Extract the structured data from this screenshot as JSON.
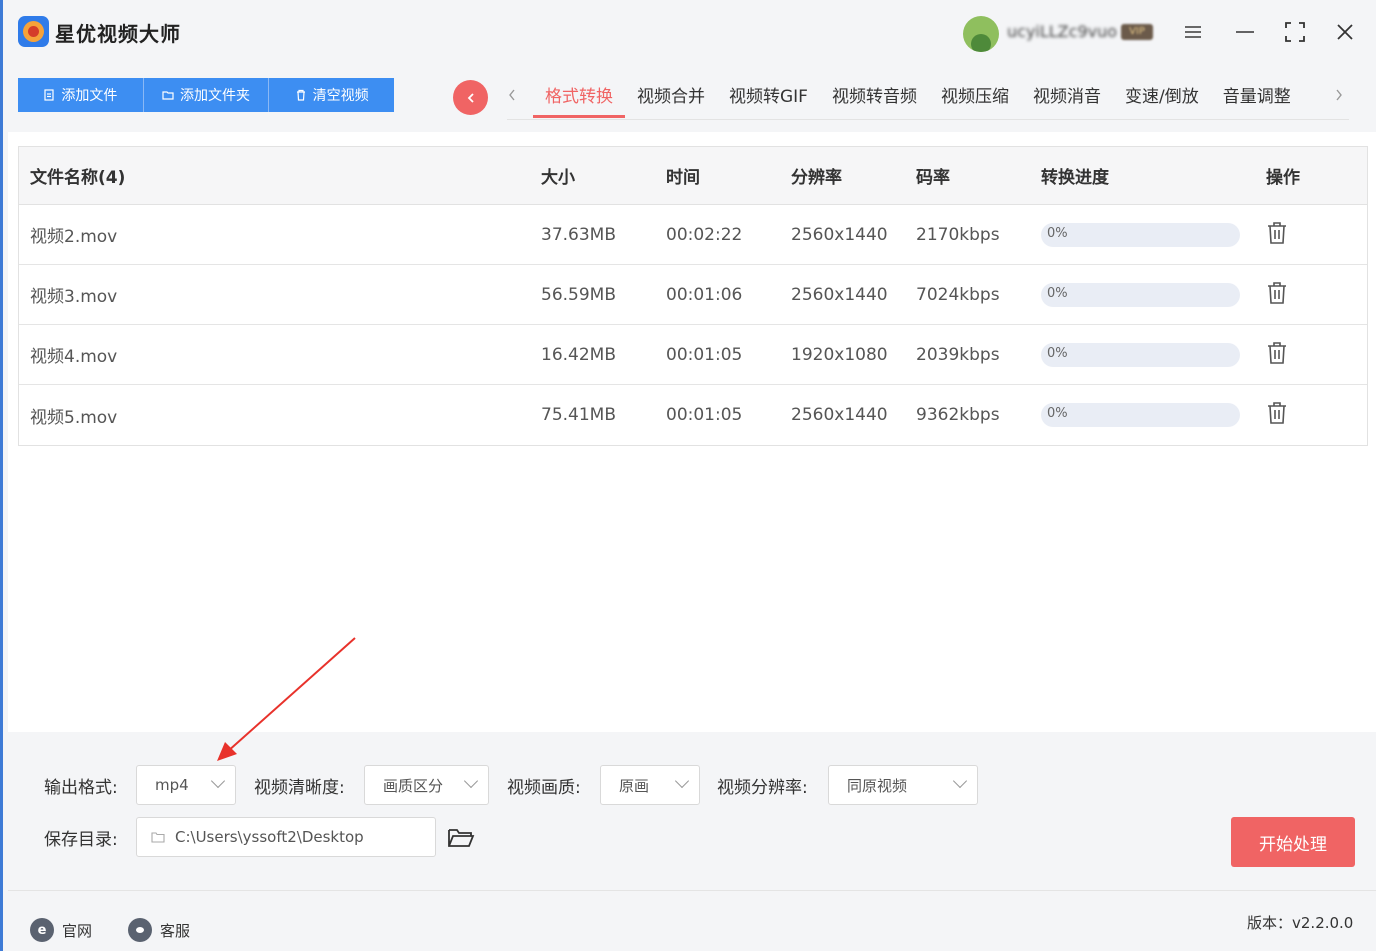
{
  "app": {
    "title": "星优视频大师"
  },
  "user": {
    "name": "ucyiLLZc9vuo",
    "badge": "VIP"
  },
  "toolbar": {
    "add_file": "添加文件",
    "add_folder": "添加文件夹",
    "clear_videos": "清空视频"
  },
  "tabs": [
    "格式转换",
    "视频合并",
    "视频转GIF",
    "视频转音频",
    "视频压缩",
    "视频消音",
    "变速/倒放",
    "音量调整"
  ],
  "active_tab": "格式转换",
  "table": {
    "headers": {
      "name": "文件名称(4)",
      "size": "大小",
      "time": "时间",
      "resolution": "分辨率",
      "bitrate": "码率",
      "progress": "转换进度",
      "actions": "操作"
    },
    "rows": [
      {
        "name": "视频2.mov",
        "size": "37.63MB",
        "time": "00:02:22",
        "resolution": "2560x1440",
        "bitrate": "2170kbps",
        "progress_text": "0%",
        "progress": 0
      },
      {
        "name": "视频3.mov",
        "size": "56.59MB",
        "time": "00:01:06",
        "resolution": "2560x1440",
        "bitrate": "7024kbps",
        "progress_text": "0%",
        "progress": 0
      },
      {
        "name": "视频4.mov",
        "size": "16.42MB",
        "time": "00:01:05",
        "resolution": "1920x1080",
        "bitrate": "2039kbps",
        "progress_text": "0%",
        "progress": 0
      },
      {
        "name": "视频5.mov",
        "size": "75.41MB",
        "time": "00:01:05",
        "resolution": "2560x1440",
        "bitrate": "9362kbps",
        "progress_text": "0%",
        "progress": 0
      }
    ]
  },
  "settings": {
    "output_format_label": "输出格式:",
    "output_format_value": "mp4",
    "clarity_label": "视频清晰度:",
    "clarity_value": "画质区分",
    "quality_label": "视频画质:",
    "quality_value": "原画",
    "resolution_label": "视频分辨率:",
    "resolution_value": "同原视频",
    "save_dir_label": "保存目录:",
    "save_dir_value": "C:\\Users\\yssoft2\\Desktop",
    "start_label": "开始处理"
  },
  "footer": {
    "website": "官网",
    "support": "客服",
    "version": "版本：v2.2.0.0"
  },
  "colors": {
    "accent_red": "#f06464",
    "accent_blue": "#3d8ef2",
    "annotation_arrow": "#e8322b"
  }
}
